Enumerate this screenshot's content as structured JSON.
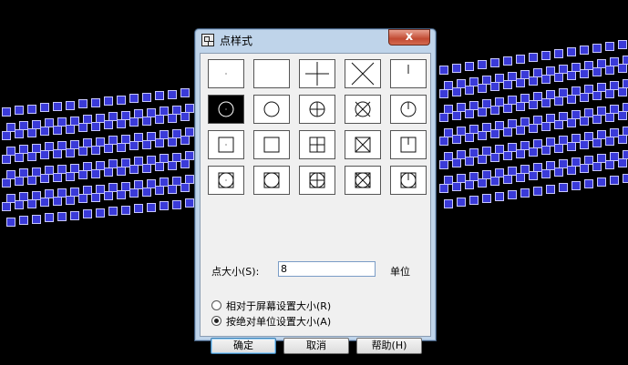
{
  "dialog": {
    "title": "点样式",
    "close_glyph": "x",
    "size_label": "点大小(S):",
    "size_value": "8",
    "unit_label": "单位",
    "radio_relative": "相对于屏幕设置大小(R)",
    "radio_absolute": "按绝对单位设置大小(A)",
    "selected_radio": "absolute",
    "ok": "确定",
    "cancel": "取消",
    "help": "帮助(H)"
  },
  "point_styles": {
    "rows": 4,
    "cols": 5,
    "selected": {
      "row": 1,
      "col": 0
    },
    "base_symbols": [
      "dot",
      "none",
      "plus",
      "cross",
      "tick"
    ],
    "row_frames": [
      "none",
      "circle",
      "square",
      "circle-square"
    ]
  },
  "colors": {
    "background": "#000000",
    "marker_fill": "#3a3ad8",
    "marker_border": "#c8c8ff"
  }
}
